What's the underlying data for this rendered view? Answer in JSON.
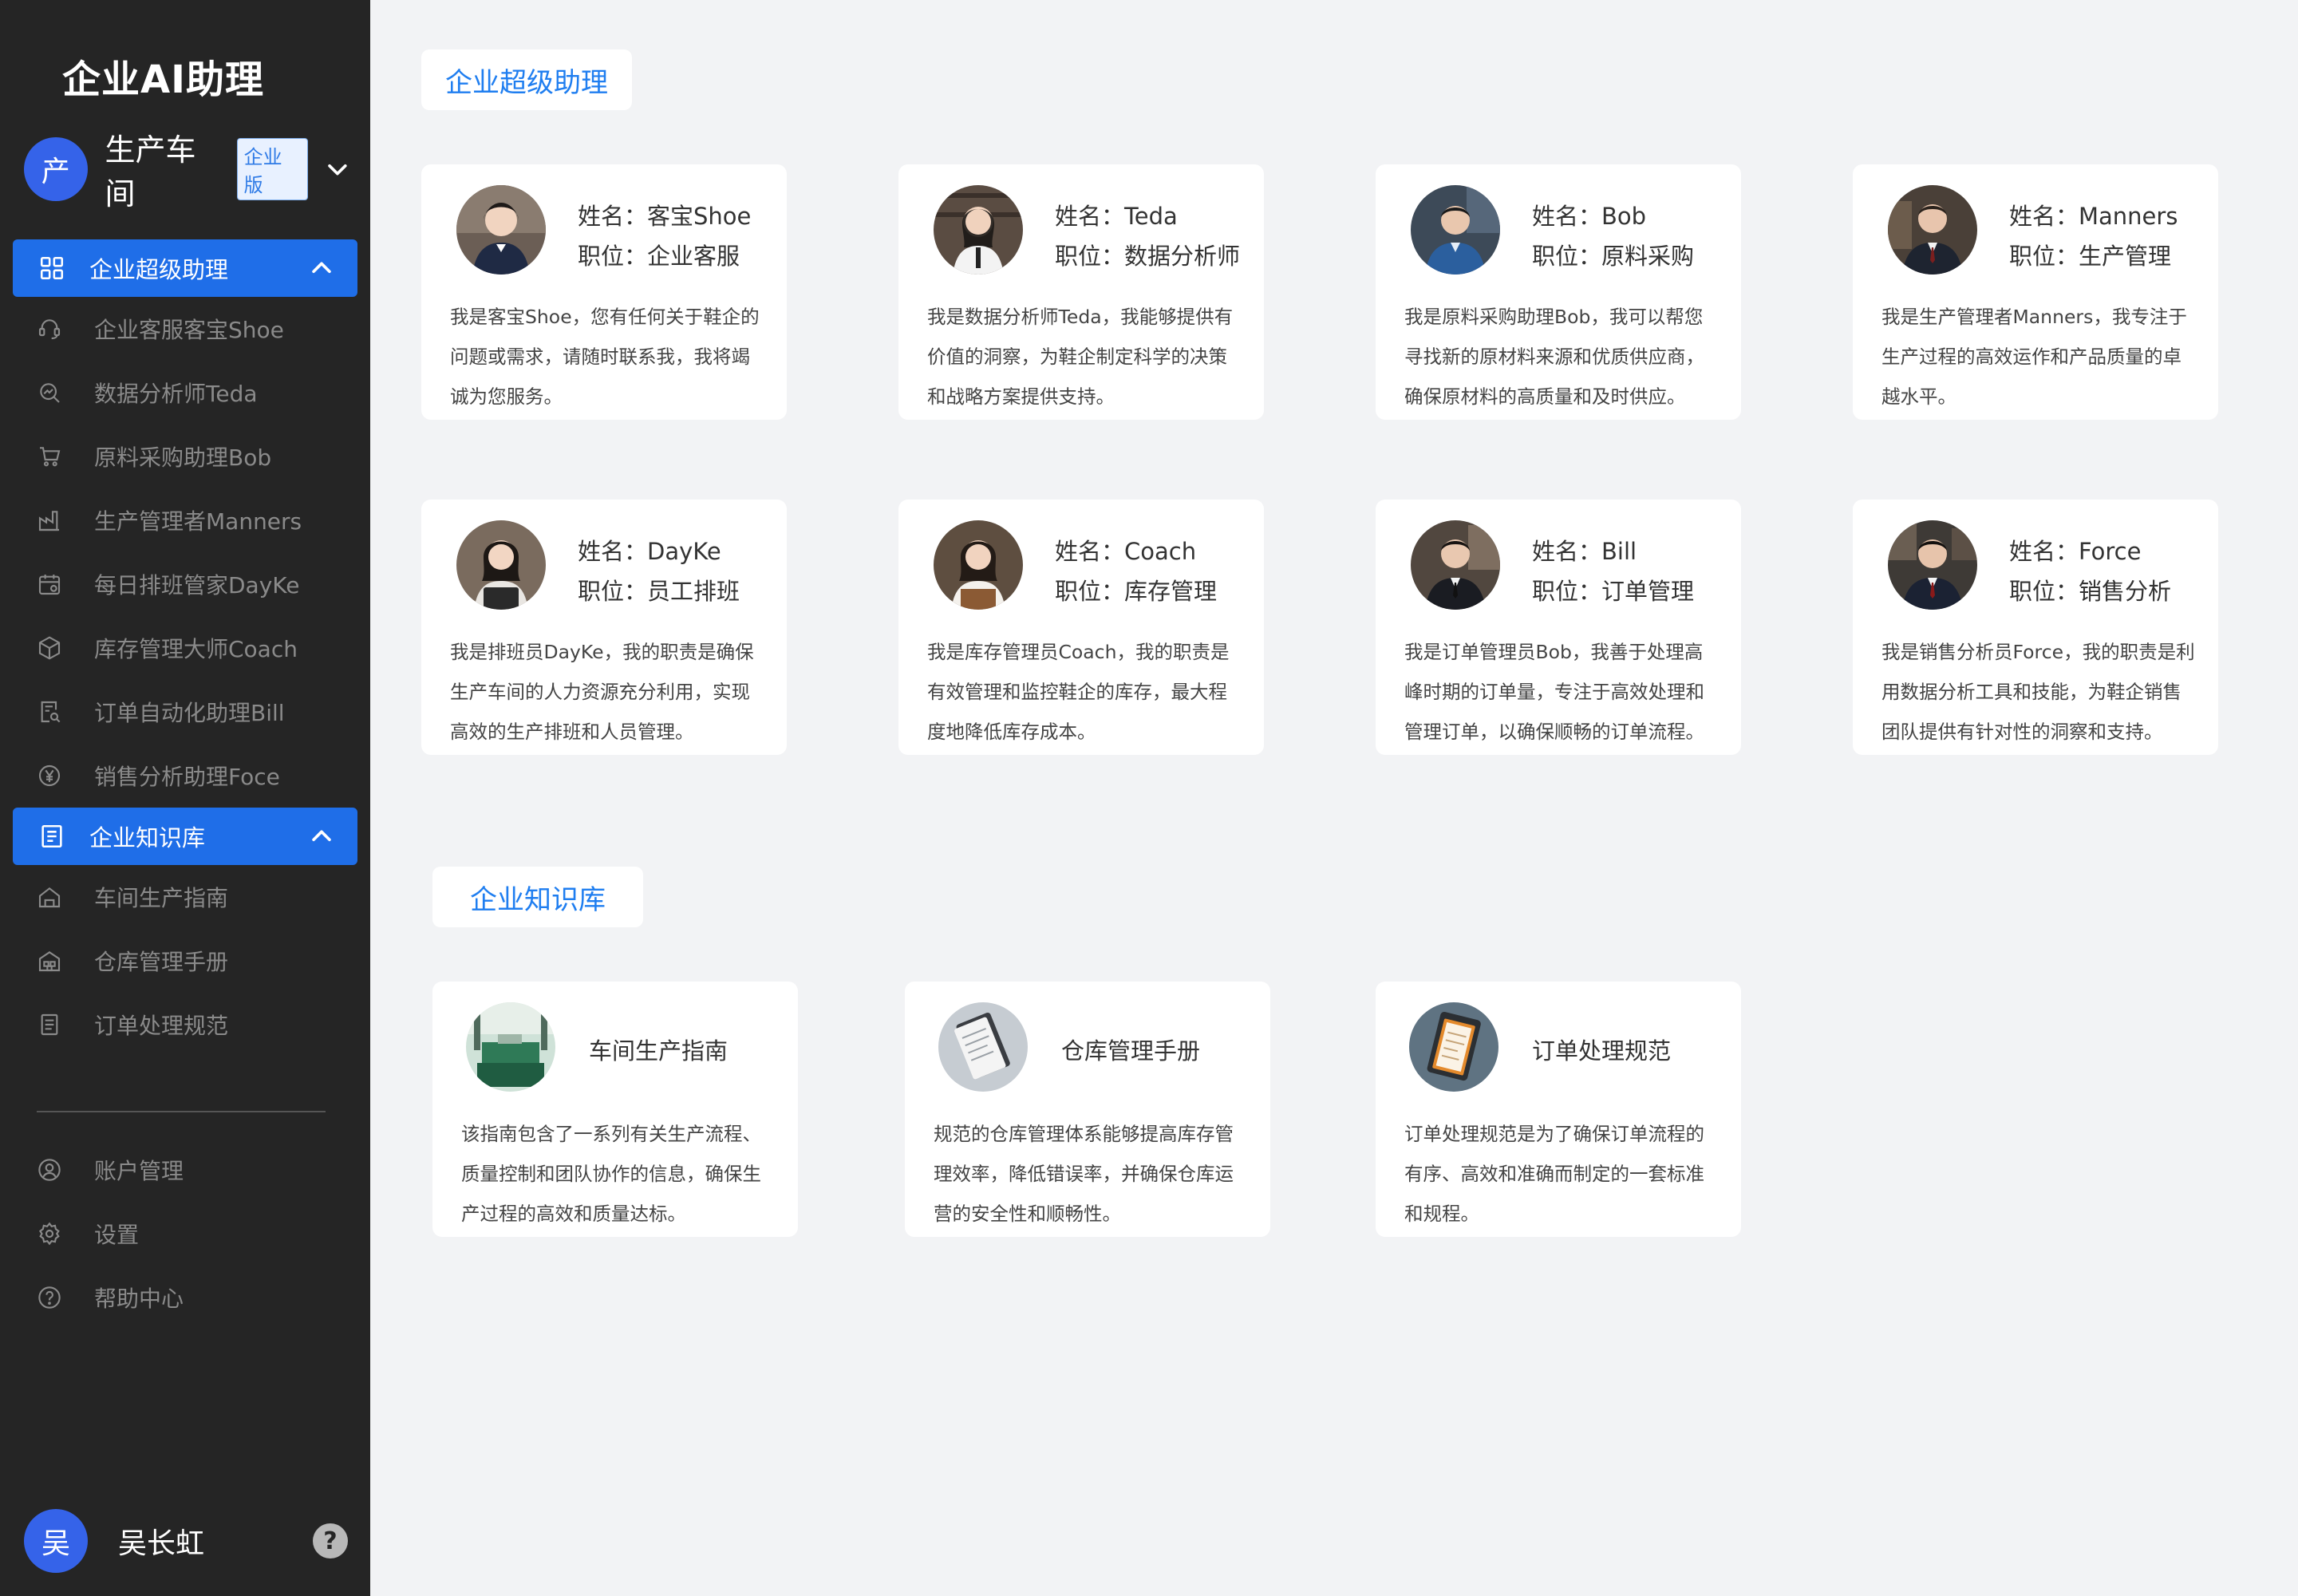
{
  "app": {
    "title": "企业AI助理"
  },
  "workspace": {
    "avatar_text": "产",
    "name": "生产车间",
    "badge": "企业版"
  },
  "nav": {
    "assistants_group": "企业超级助理",
    "assistant_items": [
      {
        "label": "企业客服客宝Shoe",
        "icon": "headset-icon"
      },
      {
        "label": "数据分析师Teda",
        "icon": "chart-search-icon"
      },
      {
        "label": "原料采购助理Bob",
        "icon": "cart-icon"
      },
      {
        "label": "生产管理者Manners",
        "icon": "factory-icon"
      },
      {
        "label": "每日排班管家DayKe",
        "icon": "calendar-icon"
      },
      {
        "label": "库存管理大师Coach",
        "icon": "box-icon"
      },
      {
        "label": "订单自动化助理Bill",
        "icon": "order-search-icon"
      },
      {
        "label": "销售分析助理Foce",
        "icon": "yen-icon"
      }
    ],
    "knowledge_group": "企业知识库",
    "knowledge_items": [
      {
        "label": "车间生产指南",
        "icon": "workshop-icon"
      },
      {
        "label": "仓库管理手册",
        "icon": "warehouse-icon"
      },
      {
        "label": "订单处理规范",
        "icon": "document-icon"
      }
    ],
    "bottom_items": [
      {
        "label": "账户管理",
        "icon": "user-icon"
      },
      {
        "label": "设置",
        "icon": "gear-icon"
      },
      {
        "label": "帮助中心",
        "icon": "help-icon"
      }
    ]
  },
  "user": {
    "avatar_text": "吴",
    "name": "吴长虹",
    "help": "?"
  },
  "sections": {
    "assistants_title": "企业超级助理",
    "knowledge_title": "企业知识库"
  },
  "assistants": [
    {
      "name_line": "姓名：客宝Shoe",
      "role_line": "职位：企业客服",
      "desc_lines": [
        "我是客宝Shoe，您有任何关于鞋企的",
        "问题或需求，请随时联系我，我将竭",
        "诚为您服务。"
      ]
    },
    {
      "name_line": "姓名：Teda",
      "role_line": "职位：数据分析师",
      "desc_lines": [
        "我是数据分析师Teda，我能够提供有",
        "价值的洞察，为鞋企制定科学的决策",
        "和战略方案提供支持。"
      ]
    },
    {
      "name_line": "姓名：Bob",
      "role_line": "职位：原料采购",
      "desc_lines": [
        "我是原料采购助理Bob，我可以帮您",
        "寻找新的原材料来源和优质供应商，",
        "确保原材料的高质量和及时供应。"
      ]
    },
    {
      "name_line": "姓名：Manners",
      "role_line": "职位：生产管理",
      "desc_lines": [
        "我是生产管理者Manners，我专注于",
        "生产过程的高效运作和产品质量的卓",
        "越水平。"
      ]
    },
    {
      "name_line": "姓名：DayKe",
      "role_line": "职位：员工排班",
      "desc_lines": [
        "我是排班员DayKe，我的职责是确保",
        "生产车间的人力资源充分利用，实现",
        "高效的生产排班和人员管理。"
      ]
    },
    {
      "name_line": "姓名：Coach",
      "role_line": "职位：库存管理",
      "desc_lines": [
        "我是库存管理员Coach，我的职责是",
        "有效管理和监控鞋企的库存，最大程",
        "度地降低库存成本。"
      ]
    },
    {
      "name_line": "姓名：Bill",
      "role_line": "职位：订单管理",
      "desc_lines": [
        "我是订单管理员Bob，我善于处理高",
        "峰时期的订单量，专注于高效处理和",
        "管理订单，以确保顺畅的订单流程。"
      ]
    },
    {
      "name_line": "姓名：Force",
      "role_line": "职位：销售分析",
      "desc_lines": [
        "我是销售分析员Force，我的职责是利",
        "用数据分析工具和技能，为鞋企销售",
        "团队提供有针对性的洞察和支持。"
      ]
    }
  ],
  "knowledge": [
    {
      "title": "车间生产指南",
      "desc_lines": [
        "该指南包含了一系列有关生产流程、",
        "质量控制和团队协作的信息，确保生",
        "产过程的高效和质量达标。"
      ]
    },
    {
      "title": "仓库管理手册",
      "desc_lines": [
        "规范的仓库管理体系能够提高库存管",
        "理效率，降低错误率，并确保仓库运",
        "营的安全性和顺畅性。"
      ]
    },
    {
      "title": "订单处理规范",
      "desc_lines": [
        "订单处理规范是为了确保订单流程的",
        "有序、高效和准确而制定的一套标准",
        "和规程。"
      ]
    }
  ]
}
